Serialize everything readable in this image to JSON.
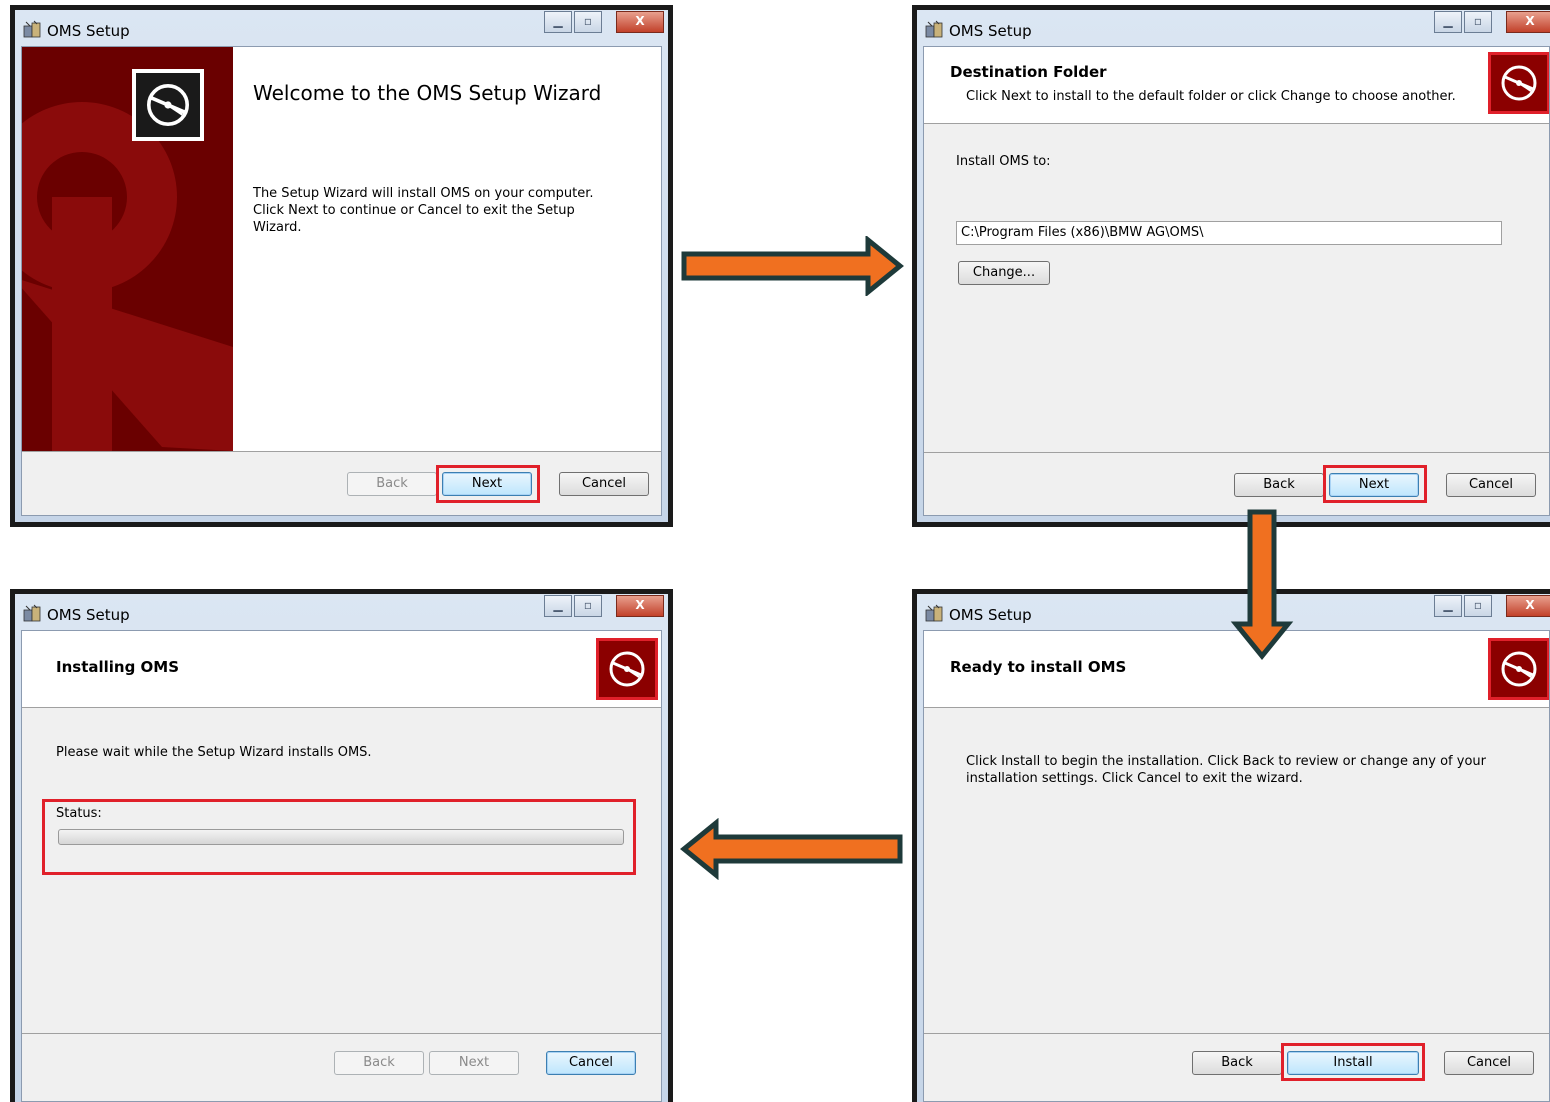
{
  "window1": {
    "title": "OMS Setup",
    "welcome_title": "Welcome to the OMS Setup Wizard",
    "body": "The Setup Wizard will install OMS on your computer. Click Next to continue or Cancel to exit the Setup Wizard.",
    "back": "Back",
    "next": "Next",
    "cancel": "Cancel"
  },
  "window2": {
    "title": "OMS Setup",
    "header_title": "Destination Folder",
    "header_sub": "Click Next to install to the default folder or click Change to choose another.",
    "install_label": "Install OMS to:",
    "path_value": "C:\\Program Files (x86)\\BMW AG\\OMS\\",
    "change": "Change...",
    "back": "Back",
    "next": "Next",
    "cancel": "Cancel"
  },
  "window3": {
    "title": "OMS Setup",
    "header_title": "Installing OMS",
    "body": "Please wait while the Setup Wizard installs OMS.",
    "status_label": "Status:",
    "progress": 0,
    "back": "Back",
    "next": "Next",
    "cancel": "Cancel"
  },
  "window4": {
    "title": "OMS Setup",
    "header_title": "Ready to install OMS",
    "body": "Click Install to begin the installation. Click Back to review or change any of your installation settings. Click Cancel to exit the wizard.",
    "back": "Back",
    "install": "Install",
    "cancel": "Cancel"
  },
  "colors": {
    "highlight": "#e0202a",
    "arrow_fill": "#f07020",
    "arrow_stroke": "#1e3a3a",
    "brand_red": "#8b0000"
  }
}
